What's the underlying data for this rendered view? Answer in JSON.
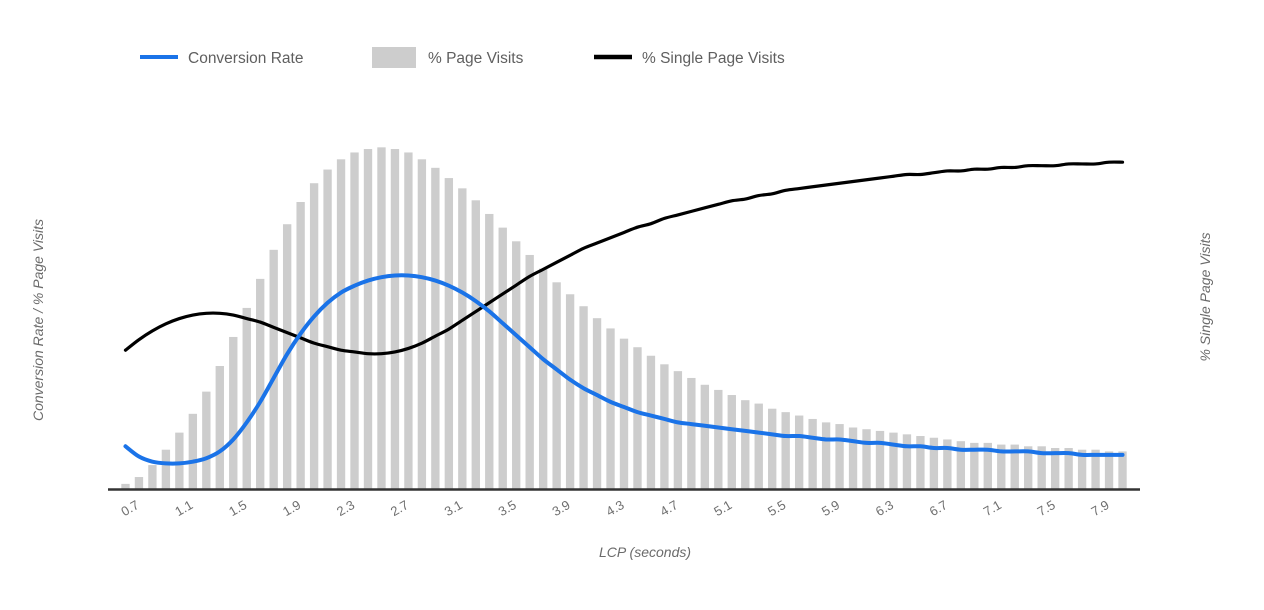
{
  "chart_data": {
    "type": "line",
    "title": "",
    "xlabel": "LCP (seconds)",
    "ylabel": "Conversion Rate / % Page Visits",
    "ylabel_right": "% Single Page Visits",
    "grid": false,
    "legend_position": "top",
    "xlim": [
      0.55,
      8.15
    ],
    "xtick_labels": [
      "0.7",
      "1.1",
      "1.5",
      "1.9",
      "2.3",
      "2.7",
      "3.1",
      "3.5",
      "3.9",
      "4.3",
      "4.7",
      "5.1",
      "5.5",
      "5.9",
      "6.3",
      "6.7",
      "7.1",
      "7.5",
      "7.9"
    ],
    "xtick_values": [
      0.7,
      1.1,
      1.5,
      1.9,
      2.3,
      2.7,
      3.1,
      3.5,
      3.9,
      4.3,
      4.7,
      5.1,
      5.5,
      5.9,
      6.3,
      6.7,
      7.1,
      7.5,
      7.9
    ],
    "legend": [
      {
        "name": "Conversion Rate",
        "type": "line",
        "color": "#1a73e8"
      },
      {
        "name": "% Page Visits",
        "type": "bar",
        "color": "#cdcdcd"
      },
      {
        "name": "% Single Page Visits",
        "type": "line",
        "color": "#000000"
      }
    ],
    "x": [
      0.65,
      0.75,
      0.85,
      0.95,
      1.05,
      1.15,
      1.25,
      1.35,
      1.45,
      1.55,
      1.65,
      1.75,
      1.85,
      1.95,
      2.05,
      2.15,
      2.25,
      2.35,
      2.45,
      2.55,
      2.65,
      2.75,
      2.85,
      2.95,
      3.05,
      3.15,
      3.25,
      3.35,
      3.45,
      3.55,
      3.65,
      3.75,
      3.85,
      3.95,
      4.05,
      4.15,
      4.25,
      4.35,
      4.45,
      4.55,
      4.65,
      4.75,
      4.85,
      4.95,
      5.05,
      5.15,
      5.25,
      5.35,
      5.45,
      5.55,
      5.65,
      5.75,
      5.85,
      5.95,
      6.05,
      6.15,
      6.25,
      6.35,
      6.45,
      6.55,
      6.65,
      6.75,
      6.85,
      6.95,
      7.05,
      7.15,
      7.25,
      7.35,
      7.45,
      7.55,
      7.65,
      7.75,
      7.85,
      7.95,
      8.05
    ],
    "series": [
      {
        "name": "% Page Visits",
        "type": "bar",
        "axis": "left",
        "color": "#cdcdcd",
        "values": [
          1.5,
          3.5,
          7.0,
          11.5,
          16.5,
          22.0,
          28.5,
          36.0,
          44.5,
          53.0,
          61.5,
          70.0,
          77.5,
          84.0,
          89.5,
          93.5,
          96.5,
          98.5,
          99.5,
          100.0,
          99.5,
          98.5,
          96.5,
          94.0,
          91.0,
          88.0,
          84.5,
          80.5,
          76.5,
          72.5,
          68.5,
          64.5,
          60.5,
          57.0,
          53.5,
          50.0,
          47.0,
          44.0,
          41.5,
          39.0,
          36.5,
          34.5,
          32.5,
          30.5,
          29.0,
          27.5,
          26.0,
          25.0,
          23.5,
          22.5,
          21.5,
          20.5,
          19.5,
          19.0,
          18.0,
          17.5,
          17.0,
          16.5,
          16.0,
          15.5,
          15.0,
          14.5,
          14.0,
          13.5,
          13.5,
          13.0,
          13.0,
          12.5,
          12.5,
          12.0,
          12.0,
          11.5,
          11.5,
          11.0,
          11.0
        ]
      },
      {
        "name": "Conversion Rate",
        "type": "line",
        "axis": "left",
        "color": "#1a73e8",
        "values": [
          12.5,
          9.5,
          8.0,
          7.5,
          7.5,
          8.0,
          9.0,
          11.0,
          14.5,
          19.5,
          25.5,
          32.5,
          39.5,
          45.5,
          50.5,
          54.5,
          57.5,
          59.5,
          61.0,
          62.0,
          62.5,
          62.5,
          62.0,
          61.0,
          59.5,
          57.5,
          55.0,
          52.0,
          48.5,
          45.0,
          41.5,
          38.0,
          35.0,
          32.0,
          29.5,
          27.5,
          25.5,
          24.0,
          22.5,
          21.5,
          20.5,
          19.5,
          19.0,
          18.5,
          18.0,
          17.5,
          17.0,
          16.5,
          16.0,
          15.5,
          15.5,
          15.0,
          14.5,
          14.5,
          14.0,
          13.5,
          13.5,
          13.0,
          12.5,
          12.5,
          12.0,
          12.0,
          11.5,
          11.5,
          11.5,
          11.0,
          11.0,
          11.0,
          10.5,
          10.5,
          10.5,
          10.0,
          10.0,
          10.0,
          10.0
        ]
      },
      {
        "name": "% Single Page Visits",
        "type": "line",
        "axis": "right",
        "color": "#000000",
        "values": [
          39.5,
          42.5,
          45.0,
          47.0,
          48.5,
          49.5,
          50.0,
          50.0,
          49.5,
          48.5,
          47.5,
          46.0,
          44.5,
          43.0,
          41.5,
          40.5,
          39.5,
          39.0,
          38.5,
          38.5,
          39.0,
          40.0,
          41.5,
          43.5,
          45.5,
          48.0,
          50.5,
          53.0,
          55.5,
          58.0,
          60.5,
          62.5,
          64.5,
          66.5,
          68.5,
          70.0,
          71.5,
          73.0,
          74.5,
          75.5,
          77.0,
          78.0,
          79.0,
          80.0,
          81.0,
          82.0,
          82.5,
          83.5,
          84.0,
          85.0,
          85.5,
          86.0,
          86.5,
          87.0,
          87.5,
          88.0,
          88.5,
          89.0,
          89.5,
          89.5,
          90.0,
          90.5,
          90.5,
          91.0,
          91.0,
          91.5,
          91.5,
          92.0,
          92.0,
          92.0,
          92.5,
          92.5,
          92.5,
          93.0,
          93.0
        ]
      }
    ],
    "ylim_left": [
      0,
      108
    ],
    "ylim_right": [
      0,
      105
    ]
  },
  "colors": {
    "blue": "#1a73e8",
    "bar_gray": "#cdcdcd",
    "black": "#000000",
    "axis": "#333333",
    "text": "#6b6b6b"
  }
}
